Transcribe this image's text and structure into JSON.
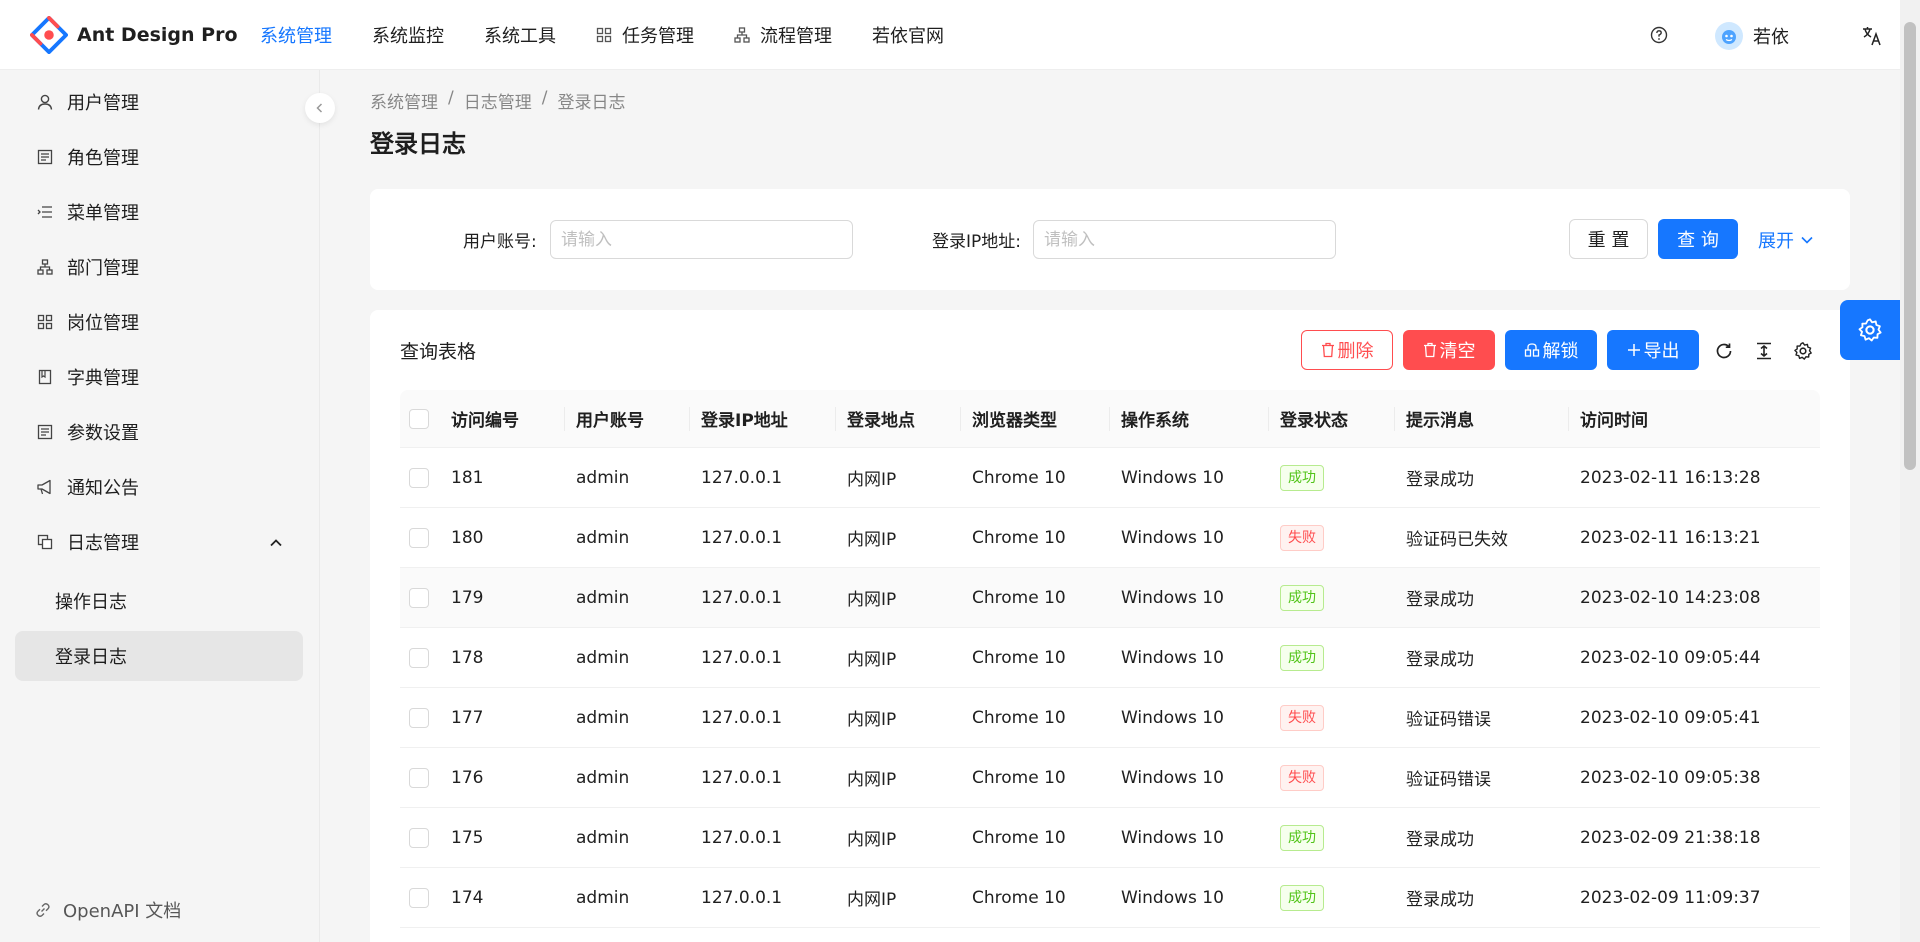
{
  "app": {
    "name": "Ant Design Pro"
  },
  "topnav": [
    {
      "label": "系统管理",
      "active": true,
      "icon": ""
    },
    {
      "label": "系统监控",
      "active": false,
      "icon": ""
    },
    {
      "label": "系统工具",
      "active": false,
      "icon": ""
    },
    {
      "label": "任务管理",
      "active": false,
      "icon": "appstore-icon"
    },
    {
      "label": "流程管理",
      "active": false,
      "icon": "cluster-icon"
    },
    {
      "label": "若依官网",
      "active": false,
      "icon": ""
    }
  ],
  "header": {
    "user_name": "若依",
    "help_icon": "question-circle-icon",
    "lang_icon": "translation-icon"
  },
  "sidebar": {
    "items": [
      {
        "label": "用户管理",
        "icon": "user-icon"
      },
      {
        "label": "角色管理",
        "icon": "profile-icon"
      },
      {
        "label": "菜单管理",
        "icon": "menu-icon"
      },
      {
        "label": "部门管理",
        "icon": "cluster-icon"
      },
      {
        "label": "岗位管理",
        "icon": "appstore-icon"
      },
      {
        "label": "字典管理",
        "icon": "book-icon"
      },
      {
        "label": "参数设置",
        "icon": "profile-icon"
      },
      {
        "label": "通知公告",
        "icon": "notification-icon"
      },
      {
        "label": "日志管理",
        "icon": "copy-icon"
      }
    ],
    "sub_items": [
      {
        "label": "操作日志",
        "selected": false
      },
      {
        "label": "登录日志",
        "selected": true
      }
    ],
    "footer": "OpenAPI 文档"
  },
  "breadcrumb": [
    "系统管理",
    "日志管理",
    "登录日志"
  ],
  "page_title": "登录日志",
  "search": {
    "user_label": "用户账号:",
    "user_placeholder": "请输入",
    "ip_label": "登录IP地址:",
    "ip_placeholder": "请输入",
    "reset_label": "重 置",
    "query_label": "查 询",
    "expand_label": "展开"
  },
  "table_card": {
    "title": "查询表格",
    "delete_label": "删除",
    "clear_label": "清空",
    "unlock_label": "解锁",
    "export_label": "导出"
  },
  "columns": [
    "访问编号",
    "用户账号",
    "登录IP地址",
    "登录地点",
    "浏览器类型",
    "操作系统",
    "登录状态",
    "提示消息",
    "访问时间"
  ],
  "rows": [
    {
      "id": "181",
      "user": "admin",
      "ip": "127.0.0.1",
      "location": "内网IP",
      "browser": "Chrome 10",
      "os": "Windows 10",
      "status": "成功",
      "ok": true,
      "msg": "登录成功",
      "time": "2023-02-11 16:13:28"
    },
    {
      "id": "180",
      "user": "admin",
      "ip": "127.0.0.1",
      "location": "内网IP",
      "browser": "Chrome 10",
      "os": "Windows 10",
      "status": "失败",
      "ok": false,
      "msg": "验证码已失效",
      "time": "2023-02-11 16:13:21"
    },
    {
      "id": "179",
      "user": "admin",
      "ip": "127.0.0.1",
      "location": "内网IP",
      "browser": "Chrome 10",
      "os": "Windows 10",
      "status": "成功",
      "ok": true,
      "msg": "登录成功",
      "time": "2023-02-10 14:23:08"
    },
    {
      "id": "178",
      "user": "admin",
      "ip": "127.0.0.1",
      "location": "内网IP",
      "browser": "Chrome 10",
      "os": "Windows 10",
      "status": "成功",
      "ok": true,
      "msg": "登录成功",
      "time": "2023-02-10 09:05:44"
    },
    {
      "id": "177",
      "user": "admin",
      "ip": "127.0.0.1",
      "location": "内网IP",
      "browser": "Chrome 10",
      "os": "Windows 10",
      "status": "失败",
      "ok": false,
      "msg": "验证码错误",
      "time": "2023-02-10 09:05:41"
    },
    {
      "id": "176",
      "user": "admin",
      "ip": "127.0.0.1",
      "location": "内网IP",
      "browser": "Chrome 10",
      "os": "Windows 10",
      "status": "失败",
      "ok": false,
      "msg": "验证码错误",
      "time": "2023-02-10 09:05:38"
    },
    {
      "id": "175",
      "user": "admin",
      "ip": "127.0.0.1",
      "location": "内网IP",
      "browser": "Chrome 10",
      "os": "Windows 10",
      "status": "成功",
      "ok": true,
      "msg": "登录成功",
      "time": "2023-02-09 21:38:18"
    },
    {
      "id": "174",
      "user": "admin",
      "ip": "127.0.0.1",
      "location": "内网IP",
      "browser": "Chrome 10",
      "os": "Windows 10",
      "status": "成功",
      "ok": true,
      "msg": "登录成功",
      "time": "2023-02-09 11:09:37"
    }
  ],
  "colors": {
    "primary": "#1677ff",
    "danger": "#ff4d4f",
    "success": "#52c41a"
  }
}
